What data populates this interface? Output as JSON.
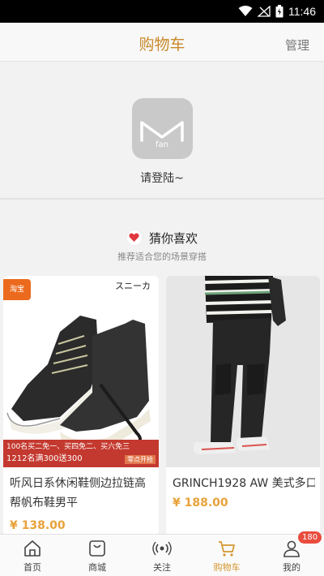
{
  "status": {
    "time": "11:46"
  },
  "header": {
    "title": "购物车",
    "manage": "管理"
  },
  "login": {
    "logo_text": "fan",
    "prompt": "请登陆~"
  },
  "recommend": {
    "title": "猜你喜欢",
    "subtitle": "推荐适合您的场景穿搭",
    "products": [
      {
        "name": "听风日系休闲鞋侧边拉链高帮帆布鞋男平",
        "price": "¥ 138.00",
        "store_badge": "淘宝",
        "img_text_top": "スニーカ",
        "promo_line1": "100名买二免一、买四免二、买六免三",
        "promo_line2": "1212名满300送300",
        "promo_tag": "零点开抢"
      },
      {
        "name": "GRINCH1928 AW 美式多口",
        "price": "¥ 188.00"
      }
    ]
  },
  "tabbar": {
    "items": [
      {
        "label": "首页",
        "icon": "home-icon"
      },
      {
        "label": "商城",
        "icon": "shop-icon"
      },
      {
        "label": "关注",
        "icon": "broadcast-icon"
      },
      {
        "label": "购物车",
        "icon": "cart-icon"
      },
      {
        "label": "我的",
        "icon": "user-icon"
      }
    ],
    "active_index": 3,
    "badge": "180",
    "active_color": "#d4962f"
  }
}
